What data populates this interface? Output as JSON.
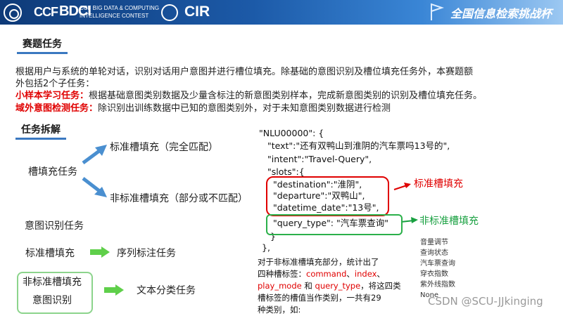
{
  "header": {
    "ccf": "CCF",
    "bdci": "BDCI",
    "sub_line1": "CCF BIG DATA & COMPUTING",
    "sub_line2": "INTELLIGENCE CONTEST",
    "cir": "CIR",
    "title_right": "全国信息检索挑战杯"
  },
  "section1": {
    "tab": "赛题任务",
    "para1_line1": "根据用户与系统的单轮对话，识别对话用户意图并进行槽位填充。除基础的意图识别及槽位填充任务外，本赛题额",
    "para1_line2": "外包括2个子任务：",
    "sub1_label": "小样本学习任务：",
    "sub1_text": "根据基础意图类别数据及少量含标注的新意图类别样本，完成新意图类别的识别及槽位填充任务。",
    "sub2_label": "域外意图检测任务：",
    "sub2_text": "除识别出训练数据中已知的意图类别外，对于未知意图类别数据进行检测"
  },
  "section2": {
    "tab": "任务拆解",
    "slot_task": "槽填充任务",
    "std_fill": "标准槽填充（完全匹配）",
    "nonstd_fill": "非标准槽填充（部分或不匹配）",
    "intent_task": "意图识别任务",
    "map1_left": "标准槽填充",
    "map1_right": "序列标注任务",
    "map2_left1": "非标准槽填充",
    "map2_left2": "意图识别",
    "map2_right": "文本分类任务"
  },
  "code": {
    "line1": "\"NLU00000\": {",
    "line2": "\"text\":\"还有双鸭山到淮阴的汽车票吗13号的\",",
    "line3": "\"intent\":\"Travel-Query\",",
    "line4": "\"slots\":{",
    "line5": "\"destination\":\"淮阴\",",
    "line6": "\"departure\":\"双鸭山\",",
    "line7": "\"datetime_date\":\"13号\",",
    "line8": "\"query_type\": \"汽车票查询\"",
    "line9": "}",
    "line10": "},"
  },
  "annotations": {
    "std": "标准槽填充",
    "nonstd": "非标准槽填充"
  },
  "note": {
    "line1": "对于非标准槽填充部分，统计出了",
    "line2a": "四种槽标签：",
    "kw1": "command",
    "sep1": "、",
    "kw2": "index",
    "sep2": "、",
    "kw3": "play_mode",
    "and": " 和 ",
    "kw4": "query_type",
    "line3b": "，将这四类",
    "line4": "槽标签的槽值当作类别，一共有29",
    "line5": "种类别，如:"
  },
  "value_list": [
    "音量调节",
    "查询状态",
    "汽车票查询",
    "穿衣指数",
    "紫外线指数",
    "None"
  ],
  "watermark": "CSDN @SCU-JJkinging",
  "colors": {
    "header_dark": "#0e3a78",
    "header_light": "#9cc8f2",
    "red": "#e00000",
    "green": "#18a040",
    "arrow_blue": "#4a8fd0",
    "arrow_green": "#5fcf4a"
  }
}
